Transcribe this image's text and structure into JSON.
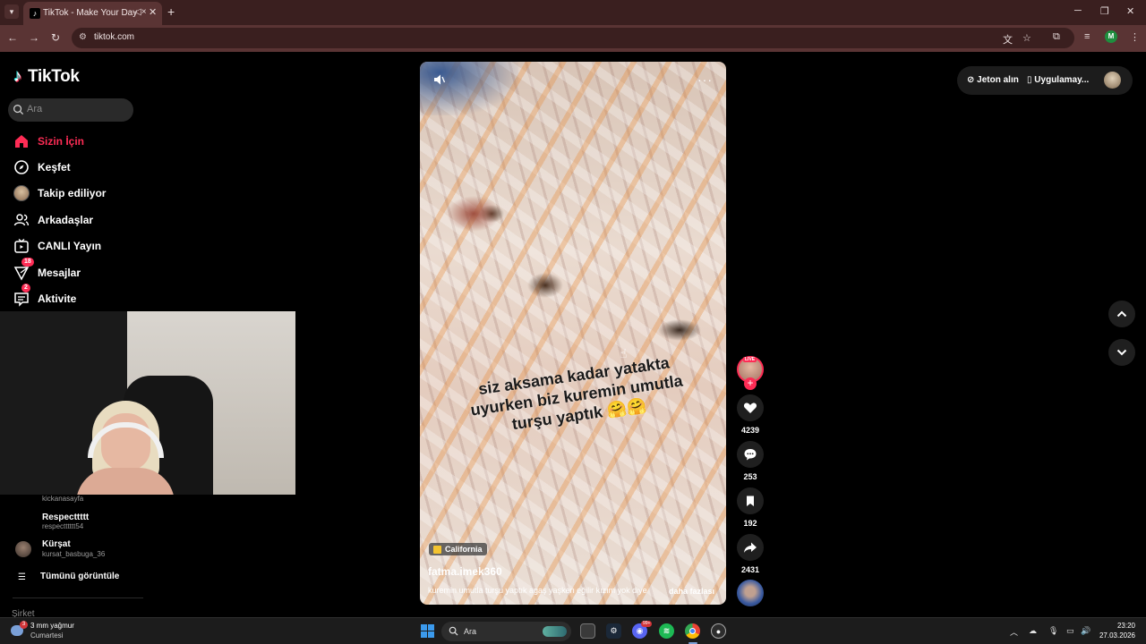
{
  "browser": {
    "tab_title": "TikTok - Make Your Day",
    "url": "tiktok.com",
    "profile_initial": "M"
  },
  "sidebar": {
    "logo": "TikTok",
    "search_placeholder": "Ara",
    "nav": [
      {
        "label": "Sizin İçin",
        "icon": "home-icon",
        "active": true
      },
      {
        "label": "Keşfet",
        "icon": "compass-icon"
      },
      {
        "label": "Takip ediliyor",
        "icon": "avatar"
      },
      {
        "label": "Arkadaşlar",
        "icon": "friends-icon"
      },
      {
        "label": "CANLI Yayın",
        "icon": "live-icon"
      },
      {
        "label": "Mesajlar",
        "icon": "messages-icon",
        "badge": "18"
      },
      {
        "label": "Aktivite",
        "icon": "activity-icon",
        "badge": "2"
      }
    ],
    "following": [
      {
        "handle": "kickanasayfa"
      },
      {
        "name": "Respecttttt",
        "handle": "respectttttt54"
      },
      {
        "name": "Kürşat",
        "handle": "kursat_basbuga_36"
      }
    ],
    "see_all": "Tümünü görüntüle",
    "section_heading": "Şirket"
  },
  "video": {
    "overlay_text": "siz aksama kadar yatakta uyurken biz kuremin umutla turşu yaptık 🤗🤗",
    "location": "California",
    "author": "fatma.imek360",
    "caption": "kuremin umutla turşu yaptık agaş yaşken eğilir kızım yok diye",
    "more_label": "daha fazlası",
    "live_label": "LIVE",
    "likes": "4239",
    "comments": "253",
    "saves": "192",
    "shares": "2431"
  },
  "header": {
    "coins_label": "Jeton alın",
    "app_label": "Uygulamay..."
  },
  "taskbar": {
    "weather": "3 mm yağmur",
    "weather_day": "Cumartesi",
    "weather_badge": "3",
    "search_label": "Ara",
    "discord_badge": "99+",
    "time": "23:20",
    "date": "27.03.2026"
  }
}
